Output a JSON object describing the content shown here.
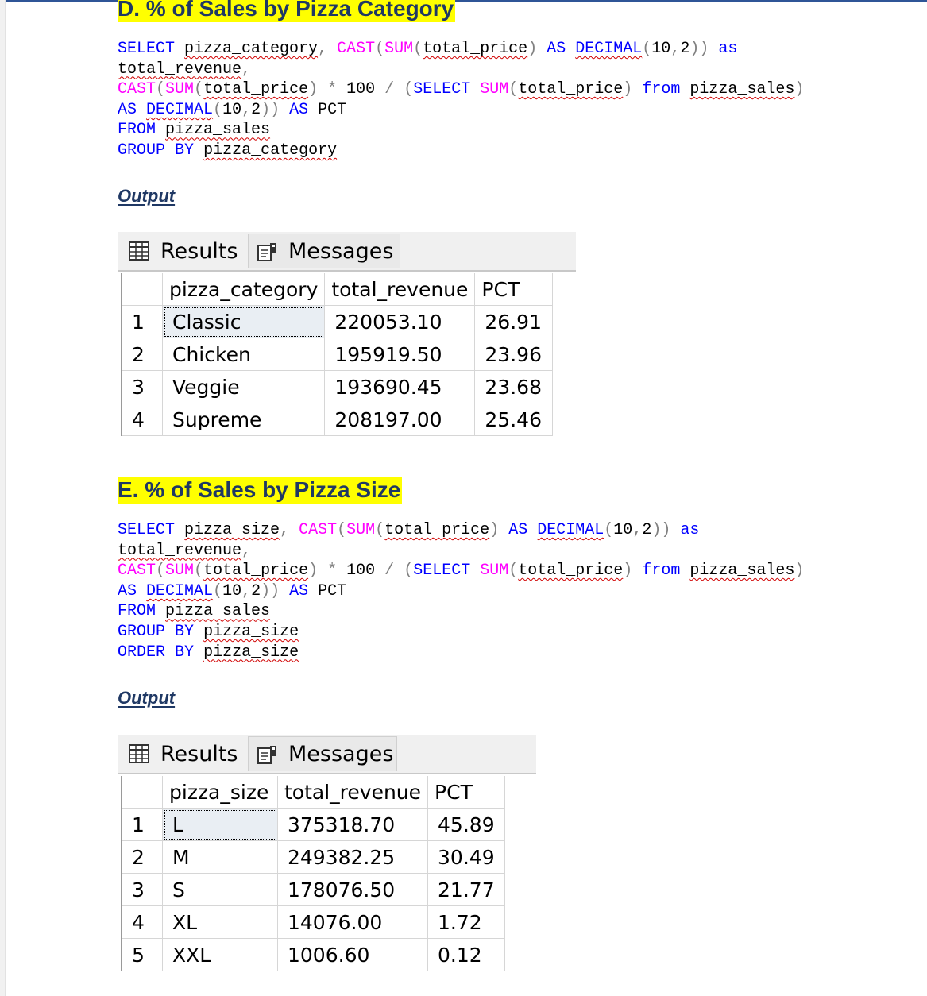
{
  "section_d": {
    "title": "D. % of Sales by Pizza Category",
    "query": [
      [
        [
          "kw",
          "SELECT"
        ],
        [
          "t",
          " "
        ],
        [
          "sq",
          "pizza_category"
        ],
        [
          "gr",
          ","
        ],
        [
          "t",
          " "
        ],
        [
          "fn",
          "CAST"
        ],
        [
          "gr",
          "("
        ],
        [
          "fn",
          "SUM"
        ],
        [
          "gr",
          "("
        ],
        [
          "sq",
          "total_price"
        ],
        [
          "gr",
          ")"
        ],
        [
          "t",
          " "
        ],
        [
          "kw",
          "AS"
        ],
        [
          "t",
          " "
        ],
        [
          "kwsq",
          "DECIMAL"
        ],
        [
          "gr",
          "("
        ],
        [
          "t",
          "10"
        ],
        [
          "gr",
          ","
        ],
        [
          "t",
          "2"
        ],
        [
          "gr",
          "))"
        ],
        [
          "t",
          " "
        ],
        [
          "kw",
          "as"
        ]
      ],
      [
        [
          "sq",
          "total_revenue"
        ],
        [
          "gr",
          ","
        ]
      ],
      [
        [
          "fn",
          "CAST"
        ],
        [
          "gr",
          "("
        ],
        [
          "fn",
          "SUM"
        ],
        [
          "gr",
          "("
        ],
        [
          "sq",
          "total_price"
        ],
        [
          "gr",
          ")"
        ],
        [
          "t",
          " "
        ],
        [
          "gr",
          "*"
        ],
        [
          "t",
          " 100 "
        ],
        [
          "gr",
          "/"
        ],
        [
          "t",
          " "
        ],
        [
          "gr",
          "("
        ],
        [
          "kw",
          "SELECT"
        ],
        [
          "t",
          " "
        ],
        [
          "fn",
          "SUM"
        ],
        [
          "gr",
          "("
        ],
        [
          "sq",
          "total_price"
        ],
        [
          "gr",
          ")"
        ],
        [
          "t",
          " "
        ],
        [
          "kw",
          "from"
        ],
        [
          "t",
          " "
        ],
        [
          "sq",
          "pizza_sales"
        ],
        [
          "gr",
          ")"
        ]
      ],
      [
        [
          "kw",
          "AS"
        ],
        [
          "t",
          " "
        ],
        [
          "kwsq",
          "DECIMAL"
        ],
        [
          "gr",
          "("
        ],
        [
          "t",
          "10"
        ],
        [
          "gr",
          ","
        ],
        [
          "t",
          "2"
        ],
        [
          "gr",
          "))"
        ],
        [
          "t",
          " "
        ],
        [
          "kw",
          "AS"
        ],
        [
          "t",
          " PCT"
        ]
      ],
      [
        [
          "kw",
          "FROM"
        ],
        [
          "t",
          " "
        ],
        [
          "sq",
          "pizza_sales"
        ]
      ],
      [
        [
          "kw",
          "GROUP"
        ],
        [
          "t",
          " "
        ],
        [
          "kw",
          "BY"
        ],
        [
          "t",
          " "
        ],
        [
          "sq",
          "pizza_category"
        ]
      ]
    ],
    "output_label": "Output",
    "tabs": {
      "results": "Results",
      "messages": "Messages"
    },
    "columns": [
      "pizza_category",
      "total_revenue",
      "PCT"
    ],
    "rows": [
      [
        "1",
        "Classic",
        "220053.10",
        "26.91"
      ],
      [
        "2",
        "Chicken",
        "195919.50",
        "23.96"
      ],
      [
        "3",
        "Veggie",
        "193690.45",
        "23.68"
      ],
      [
        "4",
        "Supreme",
        "208197.00",
        "25.46"
      ]
    ]
  },
  "section_e": {
    "title": "E. % of Sales by Pizza Size",
    "query": [
      [
        [
          "kw",
          "SELECT"
        ],
        [
          "t",
          " "
        ],
        [
          "sq",
          "pizza_size"
        ],
        [
          "gr",
          ","
        ],
        [
          "t",
          " "
        ],
        [
          "fn",
          "CAST"
        ],
        [
          "gr",
          "("
        ],
        [
          "fn",
          "SUM"
        ],
        [
          "gr",
          "("
        ],
        [
          "sq",
          "total_price"
        ],
        [
          "gr",
          ")"
        ],
        [
          "t",
          " "
        ],
        [
          "kw",
          "AS"
        ],
        [
          "t",
          " "
        ],
        [
          "kwsq",
          "DECIMAL"
        ],
        [
          "gr",
          "("
        ],
        [
          "t",
          "10"
        ],
        [
          "gr",
          ","
        ],
        [
          "t",
          "2"
        ],
        [
          "gr",
          "))"
        ],
        [
          "t",
          " "
        ],
        [
          "kw",
          "as"
        ]
      ],
      [
        [
          "sq",
          "total_revenue"
        ],
        [
          "gr",
          ","
        ]
      ],
      [
        [
          "fn",
          "CAST"
        ],
        [
          "gr",
          "("
        ],
        [
          "fn",
          "SUM"
        ],
        [
          "gr",
          "("
        ],
        [
          "sq",
          "total_price"
        ],
        [
          "gr",
          ")"
        ],
        [
          "t",
          " "
        ],
        [
          "gr",
          "*"
        ],
        [
          "t",
          " 100 "
        ],
        [
          "gr",
          "/"
        ],
        [
          "t",
          " "
        ],
        [
          "gr",
          "("
        ],
        [
          "kw",
          "SELECT"
        ],
        [
          "t",
          " "
        ],
        [
          "fn",
          "SUM"
        ],
        [
          "gr",
          "("
        ],
        [
          "sq",
          "total_price"
        ],
        [
          "gr",
          ")"
        ],
        [
          "t",
          " "
        ],
        [
          "kw",
          "from"
        ],
        [
          "t",
          " "
        ],
        [
          "sq",
          "pizza_sales"
        ],
        [
          "gr",
          ")"
        ]
      ],
      [
        [
          "kw",
          "AS"
        ],
        [
          "t",
          " "
        ],
        [
          "kwsq",
          "DECIMAL"
        ],
        [
          "gr",
          "("
        ],
        [
          "t",
          "10"
        ],
        [
          "gr",
          ","
        ],
        [
          "t",
          "2"
        ],
        [
          "gr",
          "))"
        ],
        [
          "t",
          " "
        ],
        [
          "kw",
          "AS"
        ],
        [
          "t",
          " PCT"
        ]
      ],
      [
        [
          "kw",
          "FROM"
        ],
        [
          "t",
          " "
        ],
        [
          "sq",
          "pizza_sales"
        ]
      ],
      [
        [
          "kw",
          "GROUP"
        ],
        [
          "t",
          " "
        ],
        [
          "kw",
          "BY"
        ],
        [
          "t",
          " "
        ],
        [
          "sq",
          "pizza_size"
        ]
      ],
      [
        [
          "kw",
          "ORDER"
        ],
        [
          "t",
          " "
        ],
        [
          "kw",
          "BY"
        ],
        [
          "t",
          " "
        ],
        [
          "sq",
          "pizza_size"
        ]
      ]
    ],
    "output_label": "Output",
    "tabs": {
      "results": "Results",
      "messages": "Messages"
    },
    "columns": [
      "pizza_size",
      "total_revenue",
      "PCT"
    ],
    "rows": [
      [
        "1",
        "L",
        "375318.70",
        "45.89"
      ],
      [
        "2",
        "M",
        "249382.25",
        "30.49"
      ],
      [
        "3",
        "S",
        "178076.50",
        "21.77"
      ],
      [
        "4",
        "XL",
        "14076.00",
        "1.72"
      ],
      [
        "5",
        "XXL",
        "1006.60",
        "0.12"
      ]
    ]
  },
  "icons": {
    "results_tab": "grid-icon",
    "messages_tab": "messages-icon"
  },
  "colors": {
    "keyword": "#0000ff",
    "function": "#ff00ff",
    "punctuation": "#808080",
    "heading_highlight": "#ffff00",
    "heading_text": "#1f3864"
  }
}
